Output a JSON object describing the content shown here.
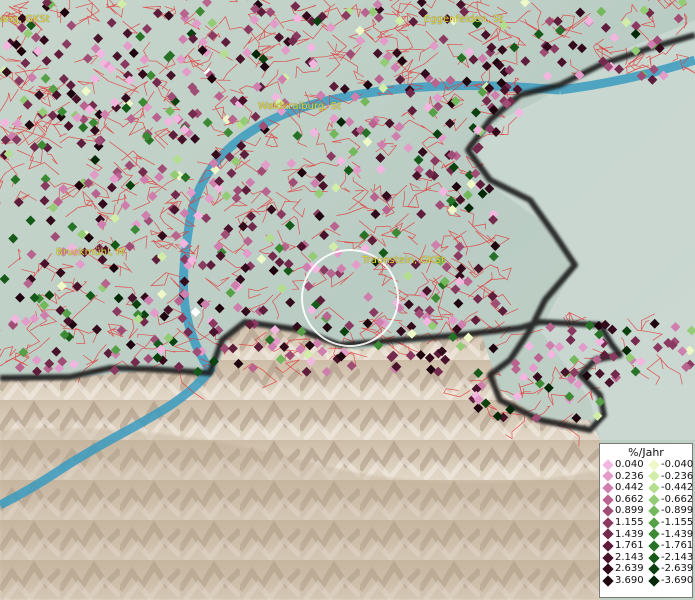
{
  "map": {
    "place_labels": [
      {
        "id": "gkst-left",
        "text": "ang, GKSt"
      },
      {
        "id": "eggenfelden",
        "text": "Eggenfelden, St"
      },
      {
        "id": "waldkraiburg",
        "text": "Waldkraiburg, St"
      },
      {
        "id": "bruckmuehl",
        "text": "Bruckmühl, M"
      },
      {
        "id": "traunstein",
        "text": "Traunstein, GKSt"
      }
    ]
  },
  "legend": {
    "title": "%/Jahr",
    "positive": [
      {
        "value": "0.040",
        "color": "#f2b6e0"
      },
      {
        "value": "0.236",
        "color": "#e39cc9"
      },
      {
        "value": "0.442",
        "color": "#cf7fad"
      },
      {
        "value": "0.662",
        "color": "#b8648f"
      },
      {
        "value": "0.899",
        "color": "#a04d76"
      },
      {
        "value": "1.155",
        "color": "#8a3a60"
      },
      {
        "value": "1.439",
        "color": "#732a4c"
      },
      {
        "value": "1.761",
        "color": "#5e1d3a"
      },
      {
        "value": "2.143",
        "color": "#48122a"
      },
      {
        "value": "2.639",
        "color": "#330a1c"
      },
      {
        "value": "3.690",
        "color": "#1e040f"
      }
    ],
    "negative": [
      {
        "value": "-0.040",
        "color": "#eef8c6"
      },
      {
        "value": "-0.236",
        "color": "#d2eda8"
      },
      {
        "value": "-0.442",
        "color": "#b3de8e"
      },
      {
        "value": "-0.662",
        "color": "#93cc74"
      },
      {
        "value": "-0.899",
        "color": "#74b85c"
      },
      {
        "value": "-1.155",
        "color": "#56a147"
      },
      {
        "value": "-1.439",
        "color": "#3d8a35"
      },
      {
        "value": "-1.761",
        "color": "#277226"
      },
      {
        "value": "-2.143",
        "color": "#155a18"
      },
      {
        "value": "-2.639",
        "color": "#0a410e"
      },
      {
        "value": "-3.690",
        "color": "#032807"
      }
    ]
  }
}
